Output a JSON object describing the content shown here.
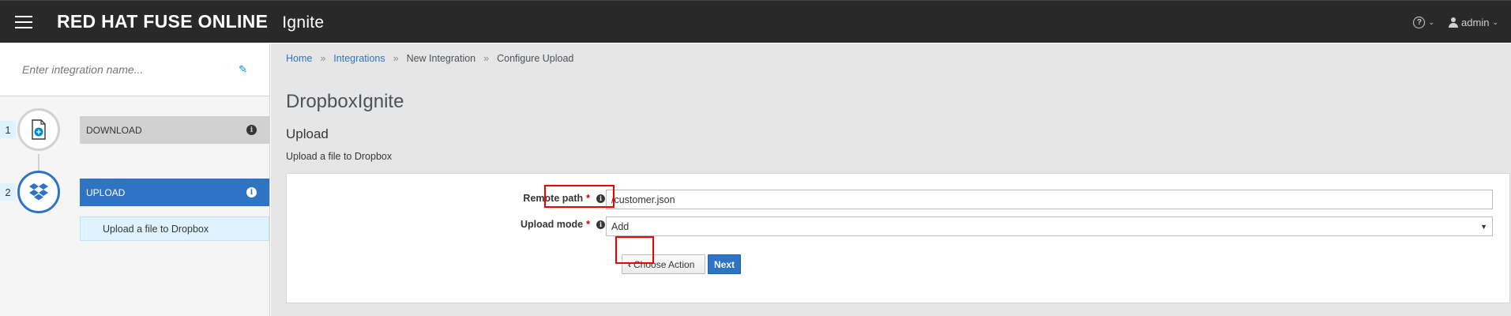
{
  "navbar": {
    "brand": "RED HAT FUSE ONLINE",
    "product": "Ignite",
    "user": "admin"
  },
  "sidebar": {
    "name_placeholder": "Enter integration name...",
    "steps": [
      {
        "number": "1",
        "label": "DOWNLOAD",
        "icon": "download-file-icon",
        "active": false
      },
      {
        "number": "2",
        "label": "UPLOAD",
        "icon": "dropbox-icon",
        "active": true
      }
    ],
    "substep": "Upload a file to Dropbox"
  },
  "breadcrumb": {
    "home": "Home",
    "integrations": "Integrations",
    "new_integration": "New Integration",
    "configure_upload": "Configure Upload",
    "separator": "»"
  },
  "page": {
    "title": "DropboxIgnite",
    "section_title": "Upload",
    "section_desc": "Upload a file to Dropbox"
  },
  "form": {
    "remote_path_label": "Remote path",
    "remote_path_value": "/customer.json",
    "upload_mode_label": "Upload mode",
    "upload_mode_value": "Add",
    "required_mark": "*",
    "choose_action_label": "Choose Action",
    "next_label": "Next"
  },
  "colors": {
    "navbar_bg": "#292929",
    "accent": "#2e73c4",
    "highlight": "#ee0000"
  }
}
